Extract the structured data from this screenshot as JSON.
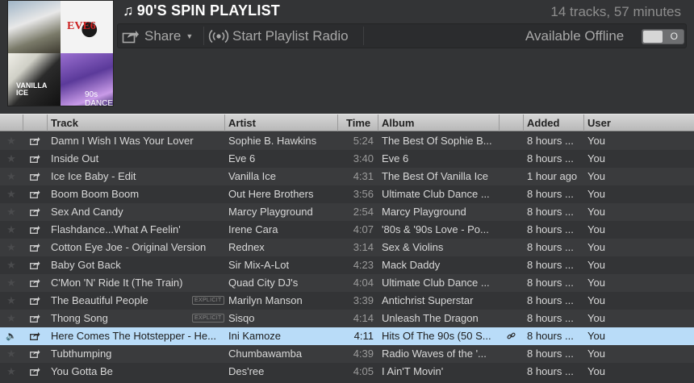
{
  "playlist": {
    "title": "90'S SPIN PLAYLIST",
    "note_glyph": "♫",
    "summary": "14 tracks, 57 minutes",
    "cover": {
      "eve6_text": "EVE6",
      "vanilla_text": "VANILLA ICE",
      "dance_text": "90s DANCE"
    }
  },
  "toolbar": {
    "share_label": "Share",
    "radio_label": "Start Playlist Radio",
    "offline_label": "Available Offline",
    "offline_toggle_text": "O",
    "offline_enabled": false
  },
  "columns": {
    "track": "Track",
    "artist": "Artist",
    "time": "Time",
    "album": "Album",
    "added": "Added",
    "user": "User"
  },
  "explicit_label": "EXPLICIT",
  "colors": {
    "selected_row": "#b9dcf8",
    "background": "#333436"
  },
  "tracks": [
    {
      "track": "Damn I Wish I Was Your Lover",
      "artist": "Sophie B. Hawkins",
      "time": "5:24",
      "album": "The Best Of Sophie B...",
      "added": "8 hours ...",
      "user": "You",
      "explicit": false
    },
    {
      "track": "Inside Out",
      "artist": "Eve 6",
      "time": "3:40",
      "album": "Eve 6",
      "added": "8 hours ...",
      "user": "You",
      "explicit": false
    },
    {
      "track": "Ice Ice Baby - Edit",
      "artist": "Vanilla Ice",
      "time": "4:31",
      "album": "The Best Of Vanilla Ice",
      "added": "1 hour ago",
      "user": "You",
      "explicit": false
    },
    {
      "track": "Boom Boom Boom",
      "artist": "Out Here Brothers",
      "time": "3:56",
      "album": "Ultimate Club Dance ...",
      "added": "8 hours ...",
      "user": "You",
      "explicit": false
    },
    {
      "track": "Sex And Candy",
      "artist": "Marcy Playground",
      "time": "2:54",
      "album": "Marcy Playground",
      "added": "8 hours ...",
      "user": "You",
      "explicit": false
    },
    {
      "track": "Flashdance...What A Feelin'",
      "artist": "Irene Cara",
      "time": "4:07",
      "album": "'80s & '90s Love - Po...",
      "added": "8 hours ...",
      "user": "You",
      "explicit": false
    },
    {
      "track": "Cotton Eye Joe - Original Version",
      "artist": "Rednex",
      "time": "3:14",
      "album": "Sex & Violins",
      "added": "8 hours ...",
      "user": "You",
      "explicit": false
    },
    {
      "track": "Baby Got Back",
      "artist": "Sir Mix-A-Lot",
      "time": "4:23",
      "album": "Mack Daddy",
      "added": "8 hours ...",
      "user": "You",
      "explicit": false
    },
    {
      "track": "C'Mon 'N' Ride It (The Train)",
      "artist": "Quad City DJ's",
      "time": "4:04",
      "album": "Ultimate Club Dance ...",
      "added": "8 hours ...",
      "user": "You",
      "explicit": false
    },
    {
      "track": "The Beautiful People",
      "artist": "Marilyn Manson",
      "time": "3:39",
      "album": "Antichrist Superstar",
      "added": "8 hours ...",
      "user": "You",
      "explicit": true
    },
    {
      "track": "Thong Song",
      "artist": "Sisqo",
      "time": "4:14",
      "album": "Unleash The Dragon",
      "added": "8 hours ...",
      "user": "You",
      "explicit": true
    },
    {
      "track": "Here Comes The Hotstepper - He...",
      "artist": "Ini Kamoze",
      "time": "4:11",
      "album": "Hits Of The 90s (50 S...",
      "added": "8 hours ...",
      "user": "You",
      "explicit": false,
      "selected": true,
      "playing": true,
      "linked": true
    },
    {
      "track": "Tubthumping",
      "artist": "Chumbawamba",
      "time": "4:39",
      "album": "Radio Waves of the '...",
      "added": "8 hours ...",
      "user": "You",
      "explicit": false
    },
    {
      "track": "You Gotta Be",
      "artist": "Des'ree",
      "time": "4:05",
      "album": "I Ain'T Movin'",
      "added": "8 hours ...",
      "user": "You",
      "explicit": false
    }
  ]
}
